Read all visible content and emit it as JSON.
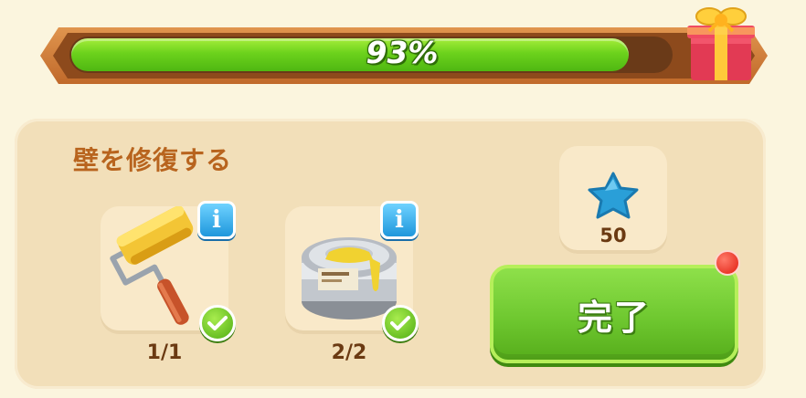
{
  "progress": {
    "label": "93%",
    "value": 0.93,
    "fill_color": "#6cd21c",
    "reward_icon": "gift-box-icon"
  },
  "task": {
    "title": "壁を修復する",
    "items": [
      {
        "icon": "paint-roller-icon",
        "count": "1/1",
        "completed": true
      },
      {
        "icon": "paint-can-icon",
        "count": "2/2",
        "completed": true
      }
    ],
    "info_glyph": "i"
  },
  "reward": {
    "icon": "blue-star-icon",
    "value": "50"
  },
  "complete_button": {
    "label": "完了",
    "has_notification": true
  }
}
